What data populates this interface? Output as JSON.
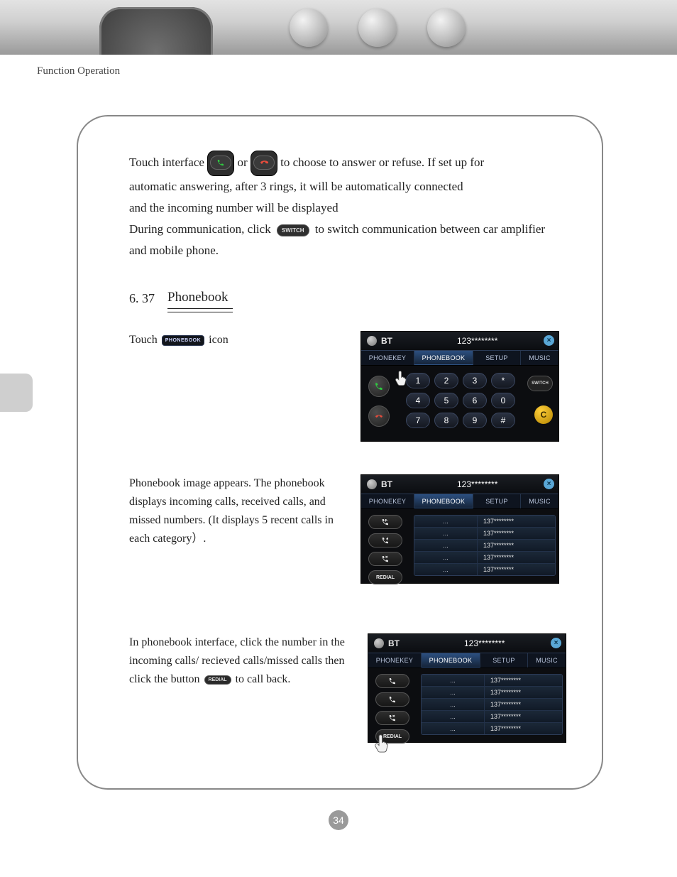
{
  "header_label": "Function Operation",
  "intro": {
    "line1a": "Touch interface",
    "line1b": "or",
    "line1c": "to choose to answer or refuse. If set up for",
    "line2": "automatic answering, after 3 rings, it will be automatically connected",
    "line3": "and the incoming number will be displayed",
    "line4a": "During communication,  click",
    "line4b": "to  switch communication between car amplifier",
    "line5": "and mobile phone."
  },
  "switch_label": "SWITCH",
  "phonebook_label": "PHONEBOOK",
  "redial_label": "REDIAL",
  "section": {
    "num": "6. 37",
    "title": "Phonebook"
  },
  "step1": {
    "a": "Touch",
    "b": "icon"
  },
  "step2": "Phonebook image appears. The phonebook displays incoming calls, received calls, and missed numbers. (It displays 5 recent calls in each category）.",
  "step3": {
    "a": "In phonebook interface, click the number in the incoming calls/ recieved calls/missed calls then click the  button",
    "b": "to call back."
  },
  "screen": {
    "bt": "BT",
    "dialed": "123********",
    "close": "×",
    "tabs": {
      "phonekey": "PHONEKEY",
      "phonebook": "PHONEBOOK",
      "setup": "SETUP",
      "music": "MUSIC"
    },
    "keys": {
      "r1": [
        "1",
        "2",
        "3",
        "*"
      ],
      "r2": [
        "4",
        "5",
        "6",
        "0"
      ],
      "r3": [
        "7",
        "8",
        "9",
        "#"
      ]
    },
    "switch": "SWITCH",
    "c": "C",
    "redial": "REDIAL",
    "list": [
      {
        "a": "...",
        "b": "137********"
      },
      {
        "a": "...",
        "b": "137********"
      },
      {
        "a": "...",
        "b": "137********"
      },
      {
        "a": "...",
        "b": "137********"
      },
      {
        "a": "...",
        "b": "137********"
      }
    ]
  },
  "page_number": "34"
}
